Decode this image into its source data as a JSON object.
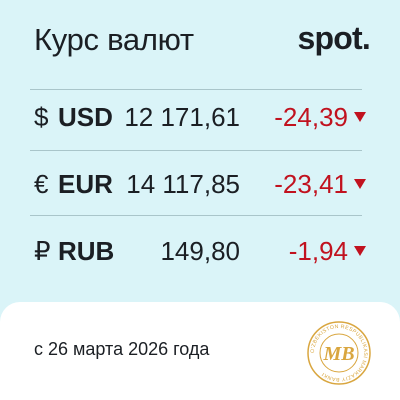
{
  "header": {
    "title": "Курс валют",
    "logo_text": "spot",
    "logo_dot": "."
  },
  "rates": [
    {
      "symbol": "$",
      "code": "USD",
      "rate": "12 171,61",
      "change": "-24,39",
      "direction": "down"
    },
    {
      "symbol": "€",
      "code": "EUR",
      "rate": "14 117,85",
      "change": "-23,41",
      "direction": "down"
    },
    {
      "symbol": "₽",
      "code": "RUB",
      "rate": "149,80",
      "change": "-1,94",
      "direction": "down"
    }
  ],
  "footer": {
    "date_text": "с 26 марта 2026 года",
    "seal": {
      "initials": "MB",
      "ring_text": "O'ZBEKISTON RESPUBLIKASI MARKAZIY BANKI"
    }
  },
  "colors": {
    "background": "#daf4f8",
    "negative": "#c1121f",
    "seal_gold": "#d9a63f",
    "footer_bg": "#ffffff"
  }
}
